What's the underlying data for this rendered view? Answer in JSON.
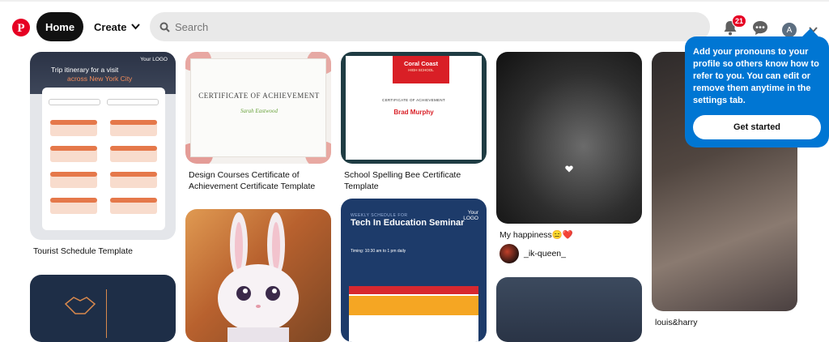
{
  "header": {
    "home_label": "Home",
    "create_label": "Create",
    "search_placeholder": "Search",
    "notification_count": "21",
    "avatar_initial": "A"
  },
  "tooltip": {
    "message": "Add your pronouns to your profile so others know how to refer to you. You can edit or remove them anytime in the settings tab.",
    "button_label": "Get started"
  },
  "pins": {
    "tourist": {
      "title": "Tourist Schedule Template",
      "image_title_1": "Trip itinerary for a visit",
      "image_title_2": "across New York City",
      "logo_text": "Your LOGO"
    },
    "design_cert": {
      "title": "Design Courses Certificate of Achievement Certificate Template",
      "image_title": "CERTIFICATE OF ACHIEVEMENT",
      "image_name": "Sarah Eastwood"
    },
    "spelling_cert": {
      "title": "School Spelling Bee Certificate Template",
      "school": "Coral Coast",
      "school_sub": "HIGH SCHOOL",
      "image_title": "CERTIFICATE OF ACHIEVEMENT",
      "image_name": "Brad Murphy"
    },
    "happiness": {
      "title": "My happiness😑❤️",
      "user": "_ik-queen_"
    },
    "louis": {
      "title": "louis&harry"
    },
    "tech": {
      "weekly": "WEEKLY SCHEDULE FOR",
      "title": "Tech In Education Seminar",
      "time": "Timing: 10:30 am to 1 pm daily",
      "logo_text": "Your LOGO"
    }
  }
}
